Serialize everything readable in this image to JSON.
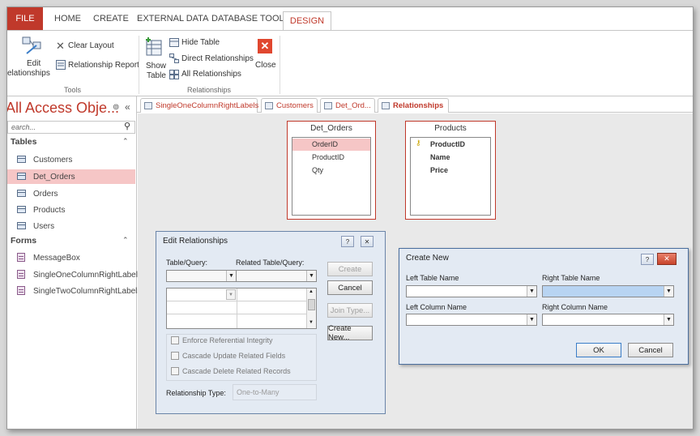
{
  "ribbon_tabs": {
    "file": "FILE",
    "home": "HOME",
    "create": "CREATE",
    "external": "EXTERNAL DATA",
    "database_tools": "DATABASE TOOLS",
    "design": "DESIGN"
  },
  "ribbon": {
    "edit_rel_1": "Edit",
    "edit_rel_2": "elationships",
    "clear_layout": "Clear Layout",
    "relationship_report": "Relationship Report",
    "tools_group": "Tools",
    "show_table_1": "Show",
    "show_table_2": "Table",
    "hide_table": "Hide Table",
    "direct_rel": "Direct Relationships",
    "all_rel": "All Relationships",
    "close": "Close",
    "relationships_group": "Relationships"
  },
  "nav": {
    "title": "All Access Obje...",
    "search_placeholder": "earch...",
    "tables_header": "Tables",
    "tables": [
      "Customers",
      "Det_Orders",
      "Orders",
      "Products",
      "Users"
    ],
    "forms_header": "Forms",
    "forms": [
      "MessageBox",
      "SingleOneColumnRightLabels",
      "SingleTwoColumnRightLabels"
    ]
  },
  "doc_tabs": [
    "SingleOneColumnRightLabels",
    "Customers",
    "Det_Ord...",
    "Relationships"
  ],
  "det_orders_box": {
    "title": "Det_Orders",
    "fields": [
      "OrderID",
      "ProductID",
      "Qty"
    ]
  },
  "products_box": {
    "title": "Products",
    "fields": [
      "ProductID",
      "Name",
      "Price"
    ]
  },
  "edit_rel_dialog": {
    "title": "Edit Relationships",
    "help": "?",
    "close": "✕",
    "table_query": "Table/Query:",
    "related_table_query": "Related Table/Query:",
    "create": "Create",
    "cancel": "Cancel",
    "join_type": "Join Type...",
    "create_new": "Create New...",
    "enforce": "Enforce Referential Integrity",
    "cascade_update": "Cascade Update Related Fields",
    "cascade_delete": "Cascade Delete Related Records",
    "relationship_type_label": "Relationship Type:",
    "relationship_type_value": "One-to-Many"
  },
  "create_new_dialog": {
    "title": "Create New",
    "help": "?",
    "close": "✕",
    "left_table": "Left Table Name",
    "right_table": "Right Table Name",
    "left_column": "Left Column Name",
    "right_column": "Right Column Name",
    "ok": "OK",
    "cancel": "Cancel"
  },
  "colors": {
    "accent": "#c0392b",
    "selection": "#f6c6c6",
    "dialog": "#e3eaf3"
  }
}
